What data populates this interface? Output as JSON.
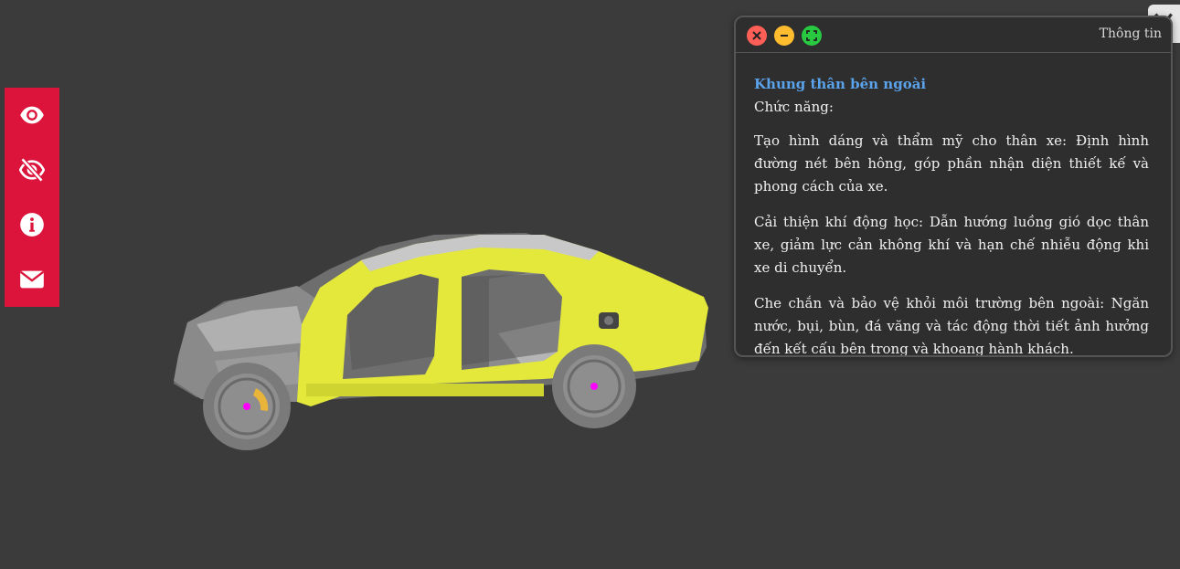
{
  "toolbar": {
    "items": [
      {
        "icon": "eye-icon"
      },
      {
        "icon": "eye-slash-icon"
      },
      {
        "icon": "info-icon"
      },
      {
        "icon": "envelope-icon"
      }
    ],
    "color": "#dc143c"
  },
  "info_window": {
    "title": "Thông tin",
    "part_name": "Khung thân bên ngoài",
    "function_label": "Chức năng:",
    "paragraphs": [
      "Tạo hình dáng và thẩm mỹ cho thân xe: Định hình đường nét bên hông, góp phần nhận diện thiết kế và phong cách của xe.",
      "Cải thiện khí động học: Dẫn hướng luồng gió dọc thân xe, giảm lực cản không khí và hạn chế nhiễu động khi xe di chuyển.",
      "Che chắn và bảo vệ khỏi môi trường bên ngoài: Ngăn nước, bụi, bùn, đá văng và tác động thời tiết ảnh hưởng đến kết cấu bên trong và khoang hành khách."
    ],
    "accent_color": "#5aa2ea"
  },
  "scene": {
    "highlight_color": "#e3e83a",
    "marker_color": "#ff00ff"
  }
}
